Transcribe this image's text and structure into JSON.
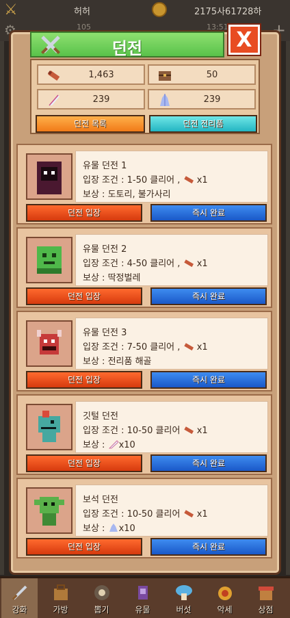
{
  "status_bar": {
    "player_name": "허허",
    "gold": "2175사61728하",
    "level": "105",
    "time": "13:51"
  },
  "dialog": {
    "title": "던전",
    "close_label": "X"
  },
  "stats": {
    "scroll": "1,463",
    "chest": "50",
    "feather": "239",
    "crystal": "239"
  },
  "tabs": {
    "list_label": "던전 목록",
    "loot_label": "던전 전리품"
  },
  "dungeons": [
    {
      "name": "유물 던전 1",
      "condition": "입장 조건 : 1-50 클리어 ,",
      "cost": "x1",
      "reward_prefix": "보상 : ",
      "reward": "도토리, 불가사리",
      "monster": "hood"
    },
    {
      "name": "유물 던전 2",
      "condition": "입장 조건 : 4-50 클리어 ,",
      "cost": "x1",
      "reward_prefix": "보상 : ",
      "reward": "딱정벌레",
      "monster": "slime"
    },
    {
      "name": "유물 던전 3",
      "condition": "입장 조건 : 7-50 클리어 ,",
      "cost": "x1",
      "reward_prefix": "보상 : ",
      "reward": "전리품 해골",
      "monster": "demon"
    },
    {
      "name": "깃털 던전",
      "condition": "입장 조건 : 10-50 클리어",
      "cost": "x1",
      "reward_prefix": "보상 : ",
      "reward": "x10",
      "monster": "dino"
    },
    {
      "name": "보석 던전",
      "condition": "입장 조건 : 10-50 클리어",
      "cost": "x1",
      "reward_prefix": "보상 : ",
      "reward": "x10",
      "monster": "goblin"
    }
  ],
  "buttons": {
    "enter_label": "던전 입장",
    "instant_label": "즉시 완료"
  },
  "nav": [
    {
      "label": "강화",
      "icon": "sword-icon"
    },
    {
      "label": "가방",
      "icon": "bag-icon"
    },
    {
      "label": "뽑기",
      "icon": "gacha-icon"
    },
    {
      "label": "유물",
      "icon": "relic-icon"
    },
    {
      "label": "버섯",
      "icon": "mushroom-icon"
    },
    {
      "label": "악세",
      "icon": "accessory-icon"
    },
    {
      "label": "상점",
      "icon": "shop-icon"
    }
  ],
  "colors": {
    "enter": "#e04a1a",
    "instant": "#1f5fd0",
    "title_bar": "#6fcf5a"
  }
}
